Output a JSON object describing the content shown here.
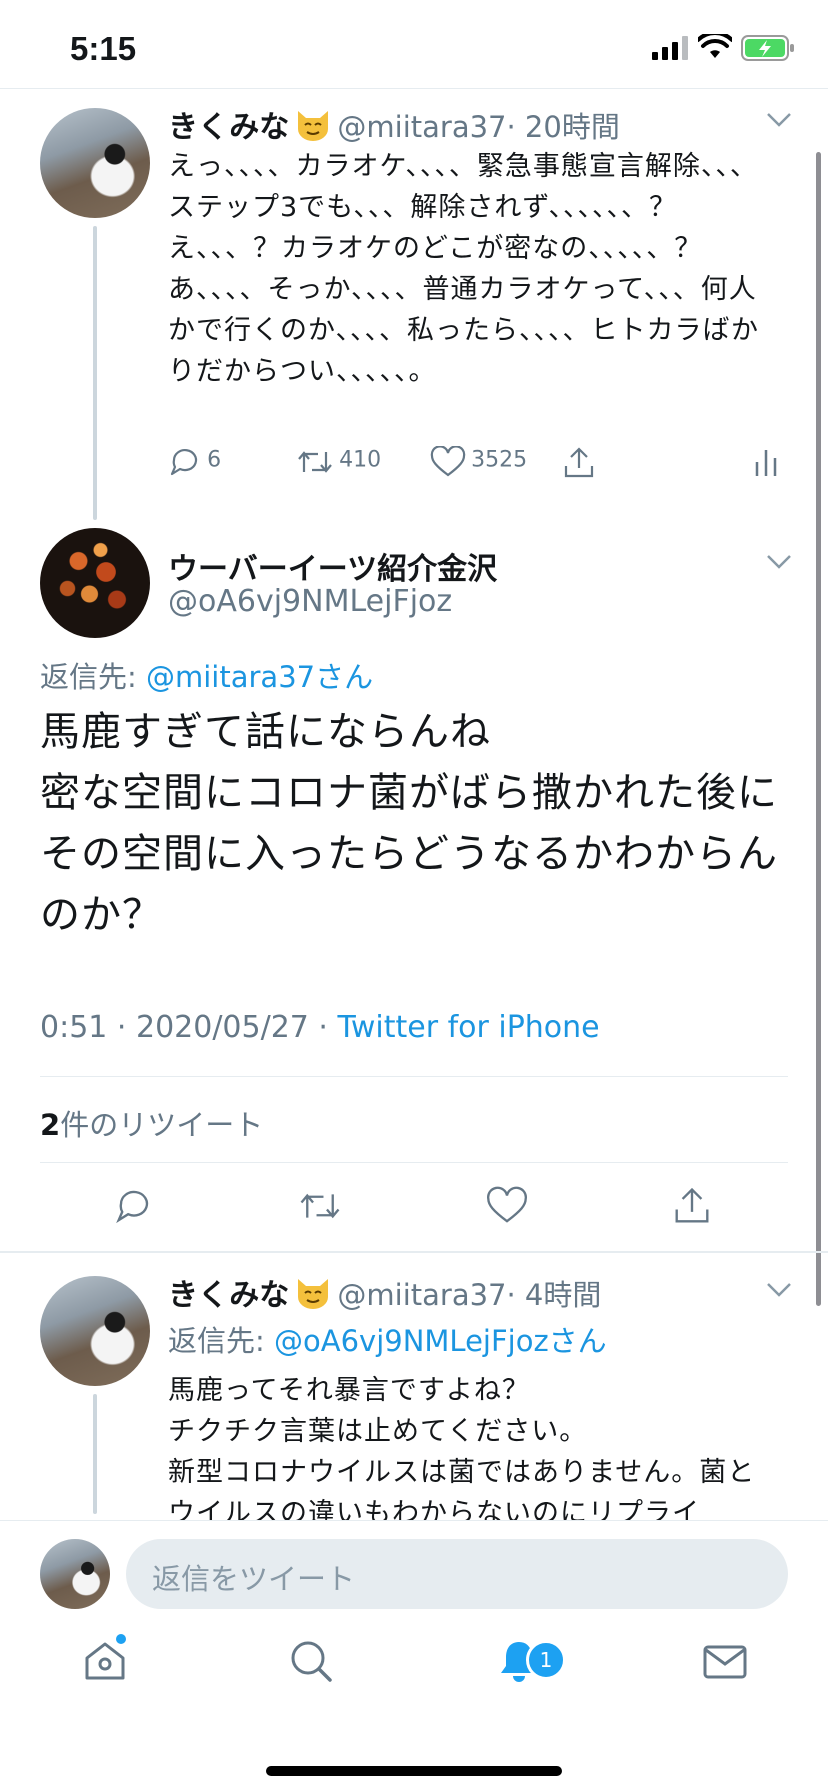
{
  "status_bar": {
    "time": "5:15"
  },
  "tweet1": {
    "name": "きくみな",
    "handle": "@miitara37",
    "time": "· 20時間",
    "text": "えっ、、、、カラオケ、、、、緊急事態宣言解除、、、ステップ3でも、、、解除されず、、、、、、？え、、、？カラオケのどこが密なの、、、、、？あ、、、、そっか、、、、普通カラオケって、、、何人かで行くのか、、、、私ったら、、、、ヒトカラばかりだからつい、、、、、。",
    "replies": "6",
    "retweets": "410",
    "likes": "3525"
  },
  "tweet2": {
    "name": "ウーバーイーツ紹介金沢",
    "handle": "@oA6vj9NMLejFjoz",
    "reply_prefix": "返信先: ",
    "reply_to": "@miitara37さん",
    "text": "馬鹿すぎて話にならんね\n密な空間にコロナ菌がばら撒かれた後にその空間に入ったらどうなるかわからんのか？",
    "timestamp": "0:51 · 2020/05/27 · ",
    "source": "Twitter for iPhone",
    "retweet_count": "2",
    "retweet_label": "件のリツイート"
  },
  "tweet3": {
    "name": "きくみな",
    "handle": "@miitara37",
    "time": "· 4時間",
    "reply_prefix": "返信先: ",
    "reply_to": "@oA6vj9NMLejFjozさん",
    "text": "馬鹿ってそれ暴言ですよね？\nチクチク言葉は止めてください。\n新型コロナウイルスは菌ではありません。菌とウイルスの違いもわからないのにリプライ"
  },
  "reply_bar": {
    "placeholder": "返信をツイート"
  },
  "tab_bar": {
    "notification_badge": "1"
  },
  "colors": {
    "accent": "#1da1f2",
    "link": "#1b95e0",
    "battery": "#4cd964"
  }
}
